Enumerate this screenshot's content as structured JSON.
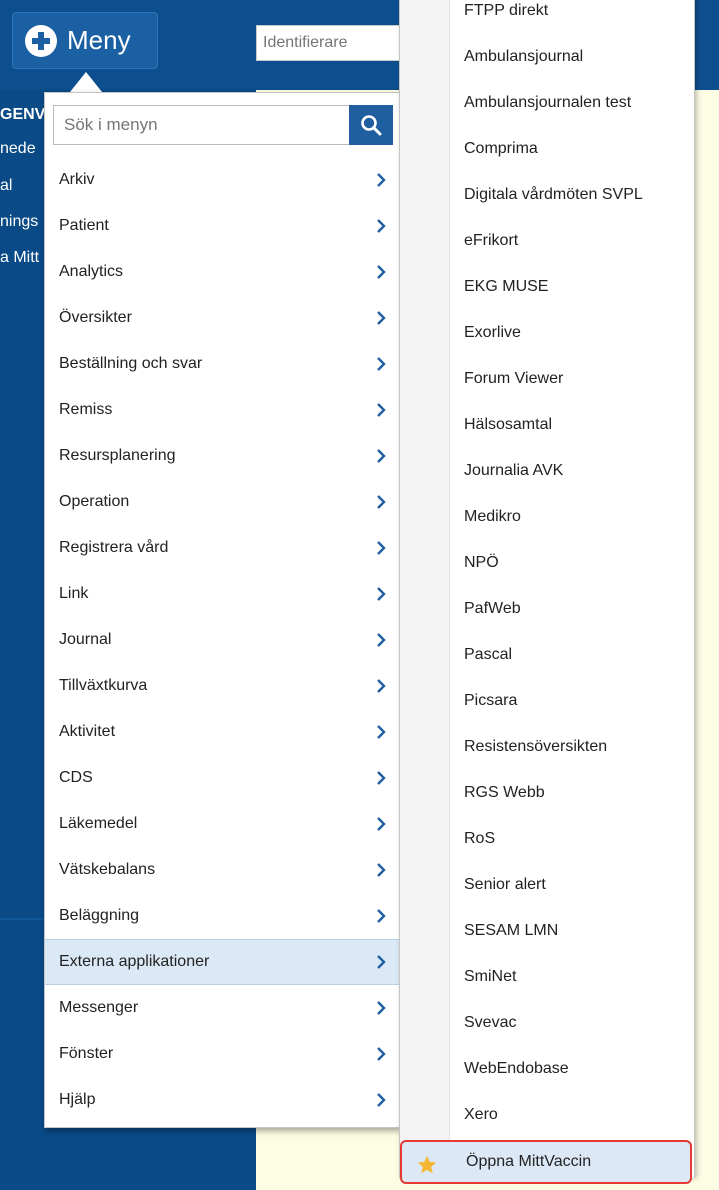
{
  "header": {
    "menu_label": "Meny",
    "identifier_placeholder": "Identifierare"
  },
  "background_left": [
    "GENV",
    "nede",
    "al",
    "nings",
    "a Mitt"
  ],
  "search": {
    "placeholder": "Sök i menyn"
  },
  "main_menu": {
    "items": [
      {
        "label": "Arkiv"
      },
      {
        "label": "Patient"
      },
      {
        "label": "Analytics"
      },
      {
        "label": "Översikter"
      },
      {
        "label": "Beställning och svar"
      },
      {
        "label": "Remiss"
      },
      {
        "label": "Resursplanering"
      },
      {
        "label": "Operation"
      },
      {
        "label": "Registrera vård"
      },
      {
        "label": "Link"
      },
      {
        "label": "Journal"
      },
      {
        "label": "Tillväxtkurva"
      },
      {
        "label": "Aktivitet"
      },
      {
        "label": "CDS"
      },
      {
        "label": "Läkemedel"
      },
      {
        "label": "Vätskebalans"
      },
      {
        "label": "Beläggning"
      },
      {
        "label": "Externa applikationer",
        "selected": true
      },
      {
        "label": "Messenger"
      },
      {
        "label": "Fönster"
      },
      {
        "label": "Hjälp"
      }
    ]
  },
  "sub_menu": {
    "items": [
      {
        "label": "FTPP direkt"
      },
      {
        "label": "Ambulansjournal"
      },
      {
        "label": "Ambulansjournalen test"
      },
      {
        "label": "Comprima"
      },
      {
        "label": "Digitala vårdmöten SVPL"
      },
      {
        "label": "eFrikort"
      },
      {
        "label": "EKG MUSE"
      },
      {
        "label": "Exorlive"
      },
      {
        "label": "Forum Viewer"
      },
      {
        "label": "Hälsosamtal"
      },
      {
        "label": "Journalia AVK"
      },
      {
        "label": "Medikro"
      },
      {
        "label": "NPÖ"
      },
      {
        "label": "PafWeb"
      },
      {
        "label": "Pascal"
      },
      {
        "label": "Picsara"
      },
      {
        "label": "Resistensöversikten"
      },
      {
        "label": "RGS Webb"
      },
      {
        "label": "RoS"
      },
      {
        "label": "Senior alert"
      },
      {
        "label": "SESAM LMN"
      },
      {
        "label": "SmiNet"
      },
      {
        "label": "Svevac"
      },
      {
        "label": "WebEndobase"
      },
      {
        "label": "Xero"
      },
      {
        "label": "Öppna MittVaccin",
        "favorite": true,
        "highlighted": true
      }
    ]
  },
  "colors": {
    "header_bg": "#0d4f8e",
    "accent": "#1f5fa0",
    "content_bg": "#fdfde4",
    "selected_bg": "#dbe8f6",
    "highlight_border": "#e53935",
    "star": "#f5b731"
  },
  "icons": {
    "menu_button": "plus-circle-icon",
    "search": "search-icon",
    "submenu_arrow": "chevron-right-icon",
    "favorite": "star-icon"
  }
}
